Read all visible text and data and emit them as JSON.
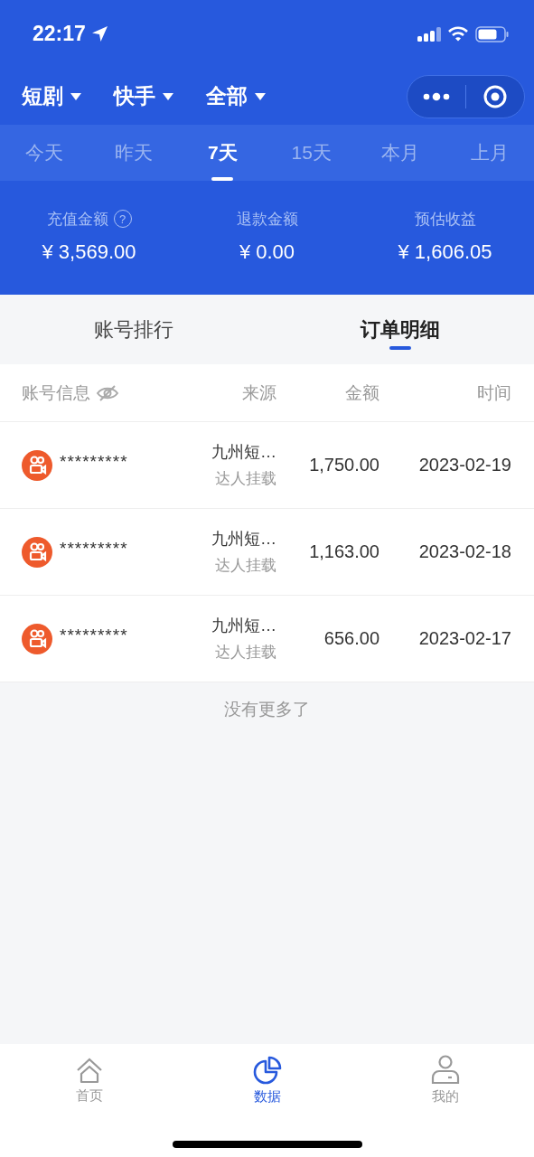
{
  "status_bar": {
    "time": "22:17"
  },
  "filters": [
    {
      "label": "短剧"
    },
    {
      "label": "快手"
    },
    {
      "label": "全部"
    }
  ],
  "periods": [
    {
      "label": "今天",
      "selected": false
    },
    {
      "label": "昨天",
      "selected": false
    },
    {
      "label": "7天",
      "selected": true
    },
    {
      "label": "15天",
      "selected": false
    },
    {
      "label": "本月",
      "selected": false
    },
    {
      "label": "上月",
      "selected": false
    }
  ],
  "summary": [
    {
      "label": "充值金额",
      "value": "¥ 3,569.00",
      "help": "?"
    },
    {
      "label": "退款金额",
      "value": "¥ 0.00"
    },
    {
      "label": "预估收益",
      "value": "¥ 1,606.05"
    }
  ],
  "view_tabs": [
    {
      "label": "账号排行",
      "selected": false
    },
    {
      "label": "订单明细",
      "selected": true
    }
  ],
  "table": {
    "columns": [
      "账号信息",
      "来源",
      "金额",
      "时间"
    ],
    "rows": [
      {
        "account": "*********",
        "source": "九州短…",
        "source_type": "达人挂载",
        "amount": "1,750.00",
        "time": "2023-02-19"
      },
      {
        "account": "*********",
        "source": "九州短…",
        "source_type": "达人挂载",
        "amount": "1,163.00",
        "time": "2023-02-18"
      },
      {
        "account": "*********",
        "source": "九州短…",
        "source_type": "达人挂载",
        "amount": "656.00",
        "time": "2023-02-17"
      }
    ]
  },
  "end_note": "没有更多了",
  "nav": [
    {
      "label": "首页",
      "kind": "home",
      "selected": false
    },
    {
      "label": "数据",
      "kind": "chart",
      "selected": true
    },
    {
      "label": "我的",
      "kind": "user",
      "selected": false
    }
  ]
}
